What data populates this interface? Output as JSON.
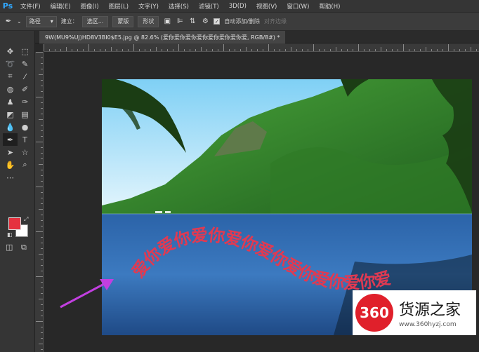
{
  "app": {
    "logo": "Ps"
  },
  "menu": [
    "文件(F)",
    "编辑(E)",
    "图像(I)",
    "图层(L)",
    "文字(Y)",
    "选择(S)",
    "滤镜(T)",
    "3D(D)",
    "视图(V)",
    "窗口(W)",
    "帮助(H)"
  ],
  "options": {
    "mode": "路径",
    "build_label": "建立：",
    "selection_btn": "选区...",
    "mask_btn": "蒙版",
    "shape_btn": "形状",
    "auto_add_label": "自动添加/删除",
    "align_edges_label": "对齐边缘"
  },
  "document": {
    "tab_title": "9W(MU9%UJ)HD8V3BI0$E5.jpg @ 82.6% (爱你爱你爱你爱你爱你爱你爱你爱, RGB/8#) *"
  },
  "canvas": {
    "warp_text": "爱你爱你爱你爱你爱你爱你爱你爱你爱"
  },
  "colors": {
    "foreground": "#e5323f",
    "background": "#ffffff",
    "accent": "#31a8ff",
    "text_color": "#e03a52",
    "arrow": "#c23fe0"
  },
  "watermark": {
    "badge": "360",
    "title": "货源之家",
    "url": "www.360hyzj.com"
  }
}
